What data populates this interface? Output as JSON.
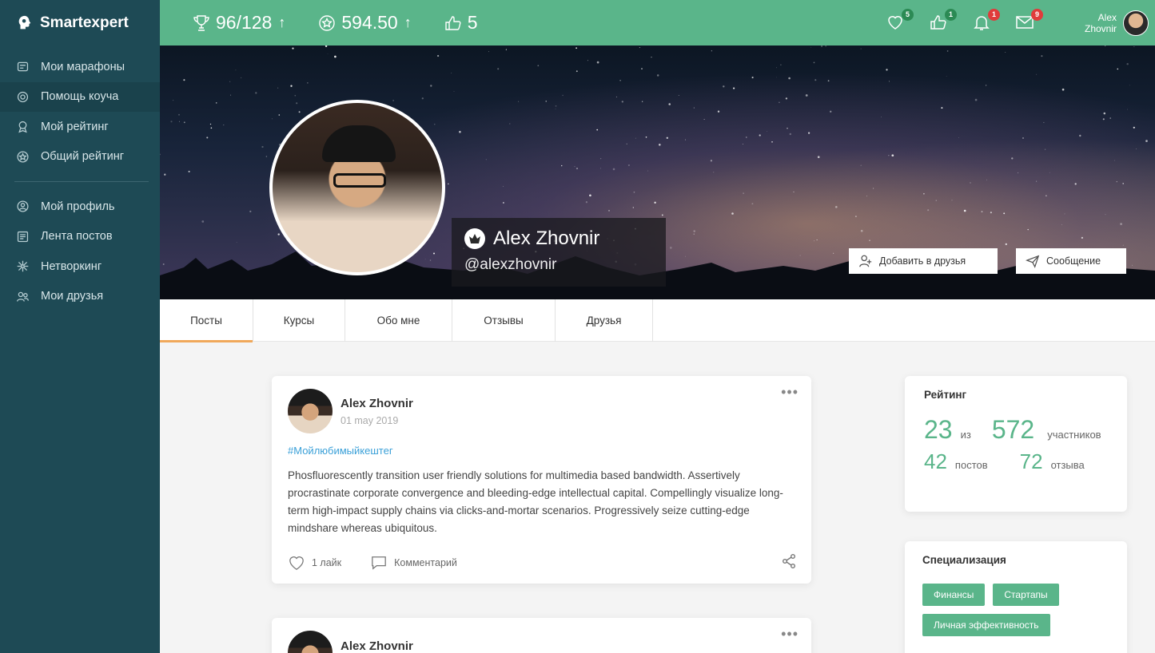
{
  "brand": {
    "name": "Smartexpert"
  },
  "sidebar": {
    "items": [
      {
        "label": "Мои марафоны",
        "icon": "marathon-icon"
      },
      {
        "label": "Помощь коуча",
        "icon": "lifebuoy-icon"
      },
      {
        "label": "Мой рейтинг",
        "icon": "medal-icon"
      },
      {
        "label": "Общий рейтинг",
        "icon": "star-badge-icon"
      }
    ],
    "items2": [
      {
        "label": "Мой профиль",
        "icon": "profile-icon"
      },
      {
        "label": "Лента постов",
        "icon": "feed-icon"
      },
      {
        "label": "Нетворкинг",
        "icon": "network-icon"
      },
      {
        "label": "Мои друзья",
        "icon": "friends-icon"
      }
    ]
  },
  "topbar": {
    "stat_trophy": "96/128",
    "stat_coins": "594.50",
    "stat_likes": "5",
    "arrow": "↑",
    "badges": {
      "favorites": "5",
      "likes": "1",
      "notifications": "1",
      "messages": "9"
    },
    "user_first": "Alex",
    "user_last": "Zhovnir"
  },
  "profile": {
    "name": "Alex Zhovnir",
    "handle": "@alexzhovnir",
    "add_friend": "Добавить в друзья",
    "message": "Сообщение"
  },
  "tabs": [
    "Посты",
    "Курсы",
    "Обо мне",
    "Отзывы",
    "Друзья"
  ],
  "post": {
    "author": "Alex Zhovnir",
    "date": "01 may 2019",
    "hashtag": "#Мойлюбимыйкештег",
    "text": "Phosfluorescently transition user friendly solutions for multimedia based bandwidth. Assertively procrastinate corporate convergence and bleeding-edge intellectual capital. Compellingly visualize long-term high-impact supply chains via clicks-and-mortar scenarios. Progressively seize cutting-edge mindshare whereas ubiquitous.",
    "likes": "1 лайк",
    "comment": "Комментарий",
    "more": "•••"
  },
  "post2": {
    "author": "Alex Zhovnir",
    "more": "•••"
  },
  "rating": {
    "title": "Рейтинг",
    "place": "23",
    "of": "из",
    "total": "572",
    "participants": "участников",
    "posts": "42",
    "posts_label": "постов",
    "reviews": "72",
    "reviews_label": "отзыва"
  },
  "specialization": {
    "title": "Специализация",
    "tags": [
      "Финансы",
      "Стартапы",
      "Личная эффективность"
    ]
  },
  "colors": {
    "accent": "#5ab58a",
    "sidebar": "#1e4a55",
    "tab_active": "#f0a85a",
    "link": "#3aa0d8"
  }
}
